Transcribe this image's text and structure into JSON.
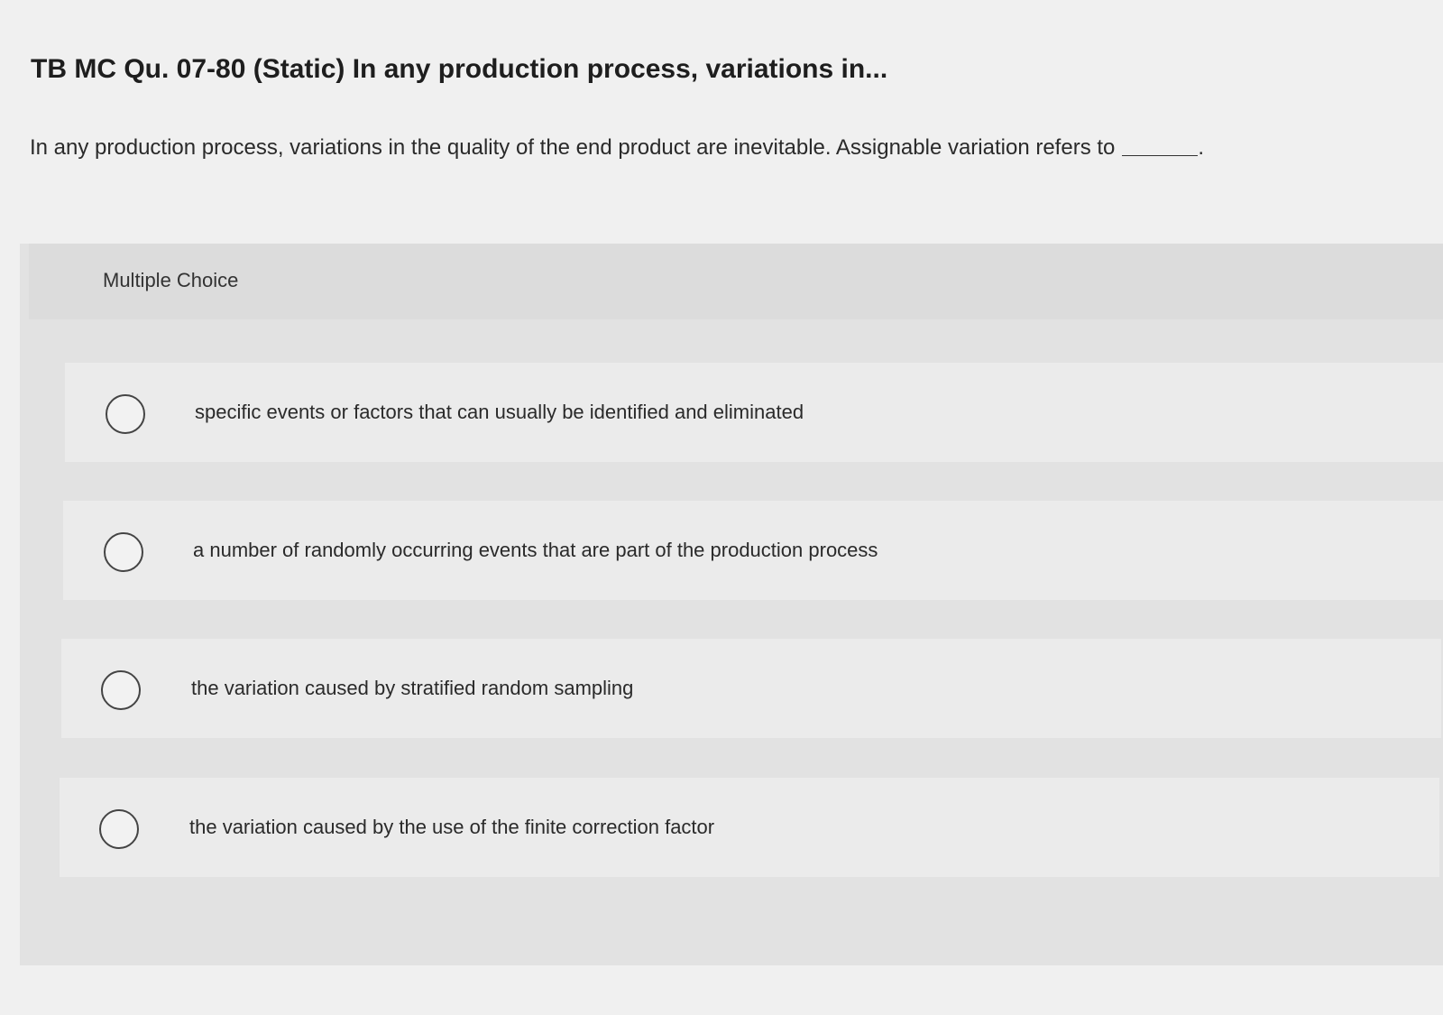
{
  "header": {
    "title": "TB MC Qu. 07-80 (Static) In any production process, variations in..."
  },
  "question": {
    "text": "In any production process, variations in the quality of the end product are inevitable. Assignable variation refers to",
    "end_punctuation": "."
  },
  "multiple_choice": {
    "label": "Multiple Choice",
    "options": [
      {
        "text": "specific events or factors that can usually be identified and eliminated"
      },
      {
        "text": "a number of randomly occurring events that are part of the production process"
      },
      {
        "text": "the variation caused by stratified random sampling"
      },
      {
        "text": "the variation caused by the use of the finite correction factor"
      }
    ]
  }
}
